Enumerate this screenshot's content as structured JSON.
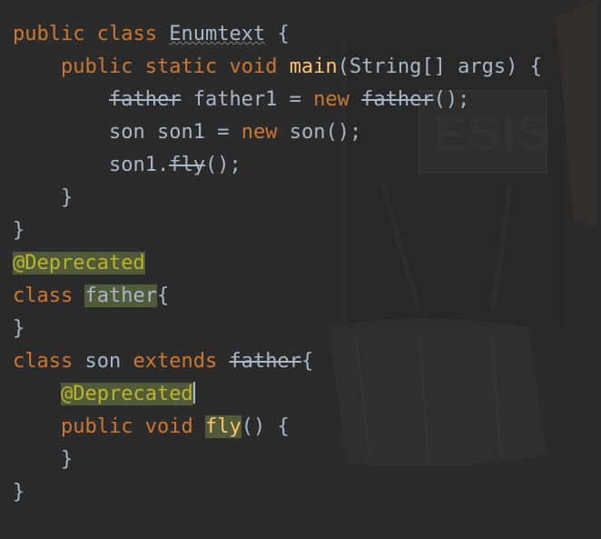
{
  "code": {
    "line1": {
      "kw1": "public",
      "kw2": "class",
      "classname": "Enumtext",
      "brace": "{"
    },
    "line2": {
      "kw1": "public",
      "kw2": "static",
      "kw3": "void",
      "method": "main",
      "params": "(String[] args) {",
      "indent": "    "
    },
    "line3": {
      "indent": "        ",
      "type": "father",
      "varname": "father1",
      "eq": " = ",
      "kw_new": "new",
      "ctor": "father",
      "tail": "();"
    },
    "line4": {
      "indent": "        ",
      "type": "son",
      "varname": "son1",
      "eq": " = ",
      "kw_new": "new",
      "ctor": "son",
      "tail": "();"
    },
    "line5": {
      "indent": "        ",
      "obj": "son1.",
      "call": "fly",
      "tail": "();"
    },
    "line6": {
      "indent": "    ",
      "brace": "}"
    },
    "line7": {
      "brace": "}"
    },
    "line8": {
      "ann": "@Deprecated"
    },
    "line9": {
      "kw": "class",
      "name": "father",
      "brace": "{"
    },
    "line10": {
      "brace": "}"
    },
    "line11": {
      "kw1": "class",
      "name": "son",
      "kw2": "extends",
      "parent": "father",
      "brace": "{"
    },
    "line12": {
      "indent": "    ",
      "ann": "@Deprecated"
    },
    "line13": {
      "indent": "    ",
      "kw1": "public",
      "kw2": "void",
      "method": "fly",
      "tail": "() {"
    },
    "line14": {
      "indent": "    ",
      "brace": "}"
    },
    "line15": {
      "brace": "}"
    }
  },
  "colors": {
    "keyword": "#cc7832",
    "annotation": "#bbb529",
    "method": "#ffc66d",
    "text": "#a9b7c6",
    "highlight": "#515b3a",
    "background": "#2b2b2b"
  }
}
